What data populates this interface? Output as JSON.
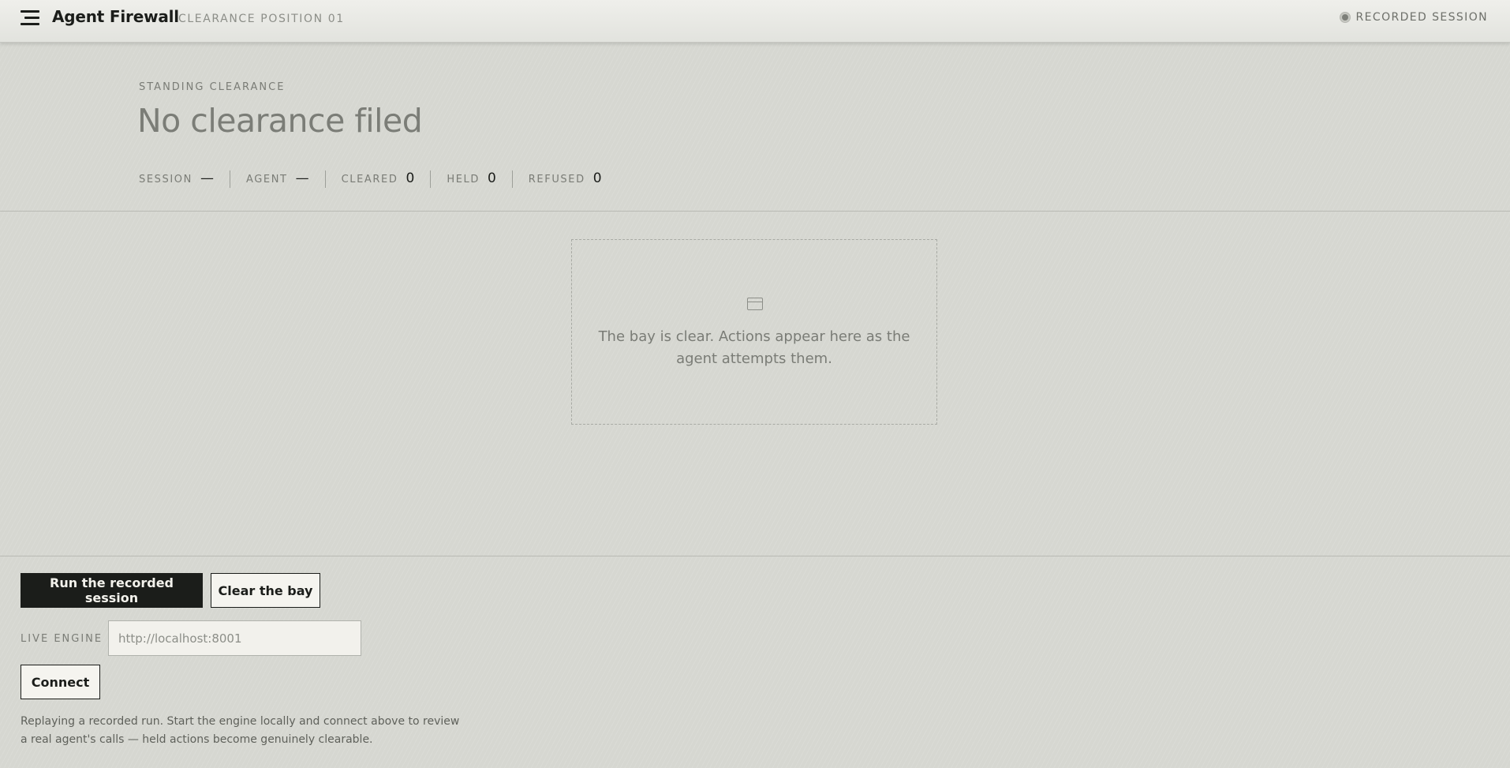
{
  "header": {
    "app_title": "Agent Firewall",
    "position": "CLEARANCE POSITION 01",
    "session_mode": "RECORDED SESSION"
  },
  "clearance": {
    "eyebrow": "STANDING CLEARANCE",
    "status": "No clearance filed",
    "stats": [
      {
        "label": "SESSION",
        "value": "—"
      },
      {
        "label": "AGENT",
        "value": "—"
      },
      {
        "label": "CLEARED",
        "value": "0"
      },
      {
        "label": "HELD",
        "value": "0"
      },
      {
        "label": "REFUSED",
        "value": "0"
      }
    ]
  },
  "bay": {
    "icon": "inbox-tray-icon",
    "empty_message": "The bay is clear. Actions appear here as the agent attempts them."
  },
  "controls": {
    "run_label": "Run the recorded session",
    "clear_label": "Clear the bay",
    "engine_label": "LIVE ENGINE",
    "engine_value": "",
    "engine_placeholder": "http://localhost:8001",
    "connect_label": "Connect",
    "hint": "Replaying a recorded run. Start the engine locally and connect above to review a real agent's calls — held actions become genuinely clearable."
  }
}
